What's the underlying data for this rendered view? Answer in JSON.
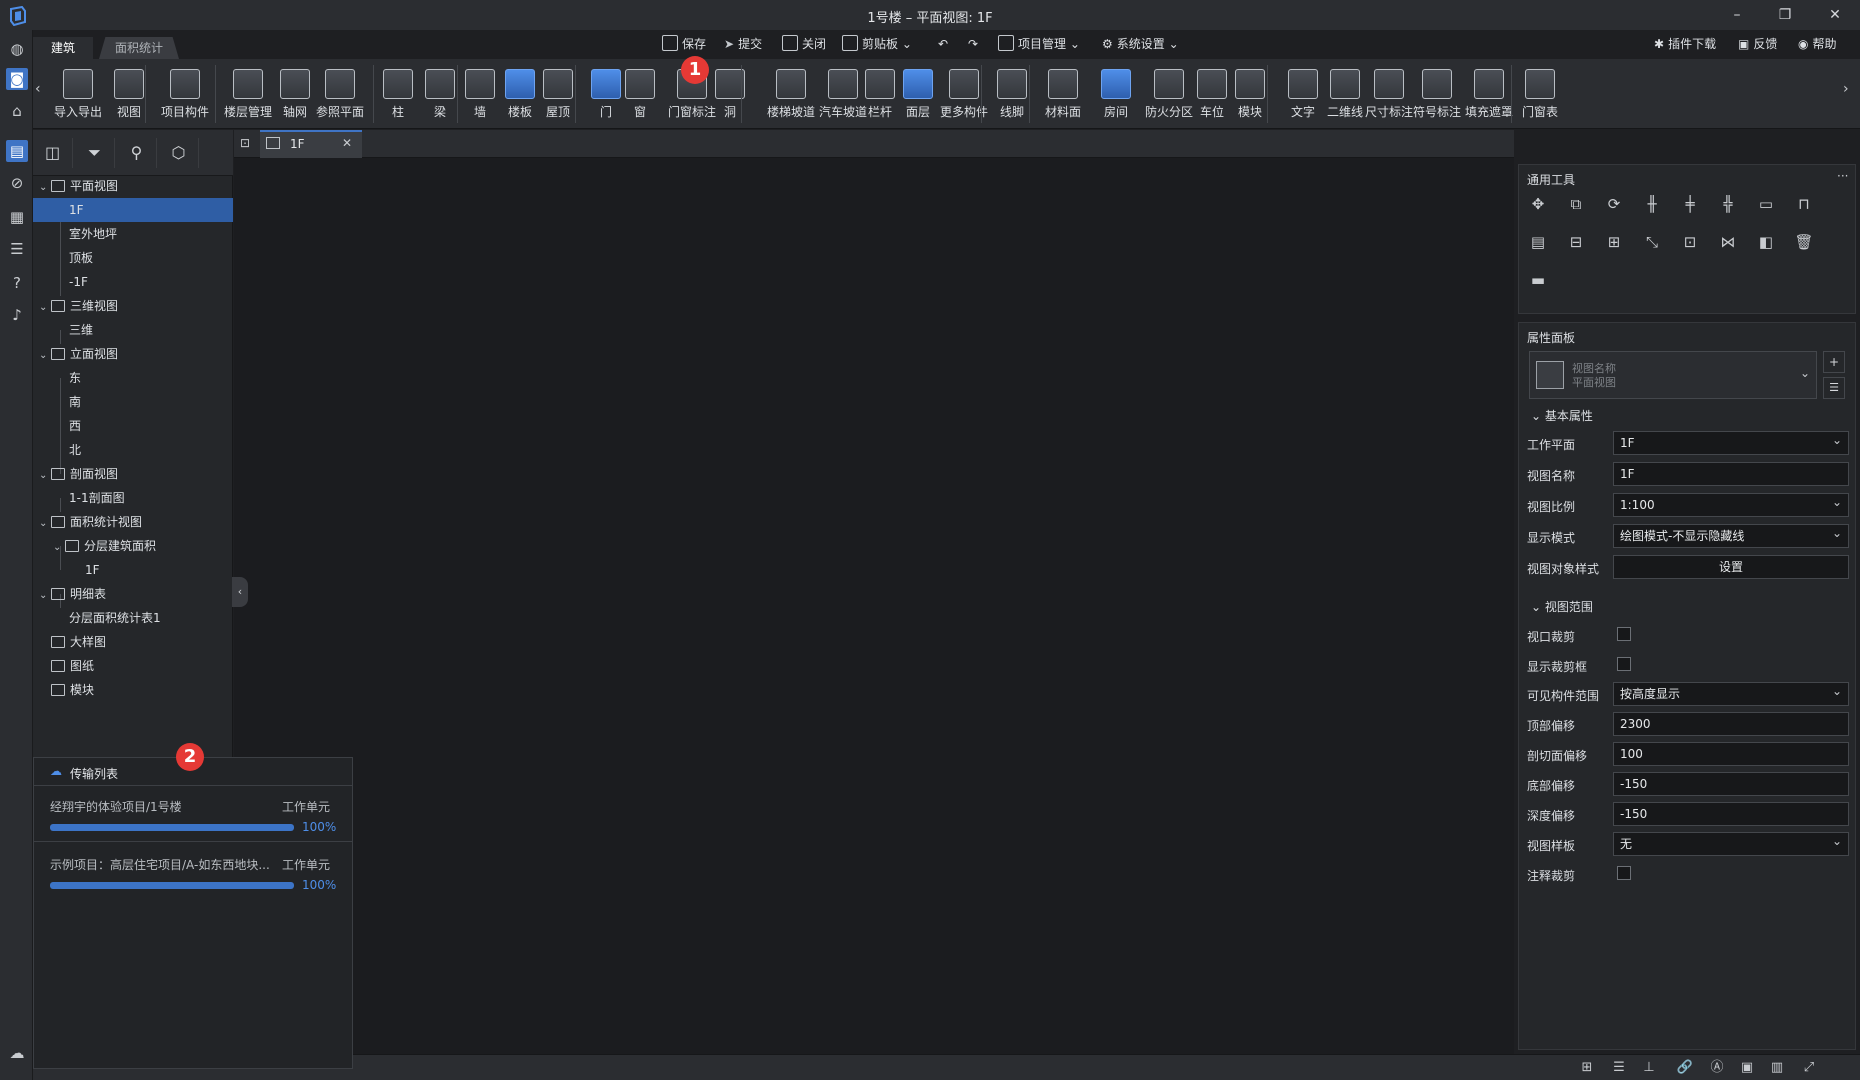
{
  "window": {
    "title": "1号楼 – 平面视图: 1F"
  },
  "ribbon_tabs": [
    "建筑",
    "面积统计"
  ],
  "quickbar": {
    "save": "保存",
    "submit": "提交",
    "close": "关闭",
    "clipboard": "剪贴板",
    "project_mgmt": "项目管理",
    "system_settings": "系统设置"
  },
  "helpbar": {
    "plugin_download": "插件下载",
    "feedback": "反馈",
    "help": "帮助"
  },
  "ribbon_buttons": [
    "导入导出",
    "视图",
    "项目构件",
    "楼层管理",
    "轴网",
    "参照平面",
    "柱",
    "梁",
    "墙",
    "楼板",
    "屋顶",
    "门",
    "窗",
    "门窗标注",
    "洞",
    "楼梯坡道",
    "汽车坡道",
    "栏杆",
    "面层",
    "更多构件",
    "线脚",
    "材料面",
    "房间",
    "防火分区",
    "车位",
    "模块",
    "文字",
    "二维线",
    "尺寸标注",
    "符号标注",
    "填充遮罩",
    "门窗表"
  ],
  "tree": {
    "plan_views": "平面视图",
    "plan_items": [
      "1F",
      "室外地坪",
      "顶板",
      "-1F"
    ],
    "three_d_views": "三维视图",
    "three_d_items": [
      "三维"
    ],
    "elevation_views": "立面视图",
    "elevation_items": [
      "东",
      "南",
      "西",
      "北"
    ],
    "section_views": "剖面视图",
    "section_items": [
      "1-1剖面图"
    ],
    "area_views": "面积统计视图",
    "area_sub": "分层建筑面积",
    "area_sub_items": [
      "1F"
    ],
    "schedules": "明细表",
    "schedule_items": [
      "分层面积统计表1"
    ],
    "detail": "大样图",
    "sheets": "图纸",
    "modules": "模块"
  },
  "view_tab": {
    "label": "1F"
  },
  "general_tools": {
    "title": "通用工具",
    "more": "···"
  },
  "properties": {
    "title": "属性面板",
    "type_label": "视图名称",
    "type_value": "平面视图",
    "basic_section": "基本属性",
    "work_plane_label": "工作平面",
    "work_plane": "1F",
    "view_name_label": "视图名称",
    "view_name": "1F",
    "scale_label": "视图比例",
    "scale": "1:100",
    "display_mode_label": "显示模式",
    "display_mode": "绘图模式-不显示隐藏线",
    "object_style_label": "视图对象样式",
    "object_style_btn": "设置",
    "range_section": "视图范围",
    "crop_label": "视口裁剪",
    "show_crop_label": "显示裁剪框",
    "visible_range_label": "可见构件范围",
    "visible_range": "按高度显示",
    "top_offset_label": "顶部偏移",
    "top_offset": "2300",
    "cut_offset_label": "剖切面偏移",
    "cut_offset": "100",
    "bottom_offset_label": "底部偏移",
    "bottom_offset": "-150",
    "depth_offset_label": "深度偏移",
    "depth_offset": "-150",
    "template_label": "视图样板",
    "template": "无",
    "annotation_crop_label": "注释裁剪"
  },
  "transfer": {
    "title": "传输列表",
    "items": [
      {
        "name": "经翔宇的体验项目/1号楼",
        "type": "工作单元",
        "progress": 1.0,
        "pct": "100%"
      },
      {
        "name": "示例项目：高层住宅项目/A-如东西地块...",
        "type": "工作单元",
        "progress": 1.0,
        "pct": "100%"
      }
    ]
  },
  "badges": [
    "1",
    "2"
  ],
  "colors": {
    "accent": "#3f74c5",
    "badge": "#e53935",
    "progress": "#3c74c7"
  }
}
